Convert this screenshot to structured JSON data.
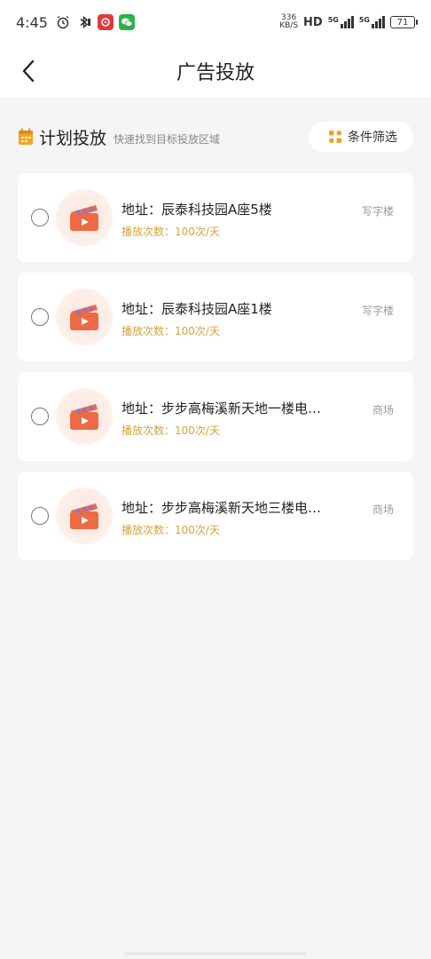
{
  "status_bar": {
    "time": "4:45",
    "net_speed_value": "336",
    "net_speed_unit": "KB/S",
    "hd": "HD",
    "signal_1": "5G",
    "signal_2": "5G",
    "battery": "71"
  },
  "nav": {
    "title": "广告投放"
  },
  "section": {
    "title": "计划投放",
    "subtitle": "快速找到目标投放区域",
    "filter_label": "条件筛选"
  },
  "cards": [
    {
      "address": "地址：辰泰科技园A座5楼",
      "plays": "播放次数：100次/天",
      "type": "写字楼"
    },
    {
      "address": "地址：辰泰科技园A座1楼",
      "plays": "播放次数：100次/天",
      "type": "写字楼"
    },
    {
      "address": "地址：步步高梅溪新天地一楼电…",
      "plays": "播放次数：100次/天",
      "type": "商场"
    },
    {
      "address": "地址：步步高梅溪新天地三楼电…",
      "plays": "播放次数：100次/天",
      "type": "商场"
    }
  ],
  "colors": {
    "accent_orange": "#ee6a45",
    "plays_gold": "#d6a33b",
    "calendar_orange": "#f3a623"
  }
}
